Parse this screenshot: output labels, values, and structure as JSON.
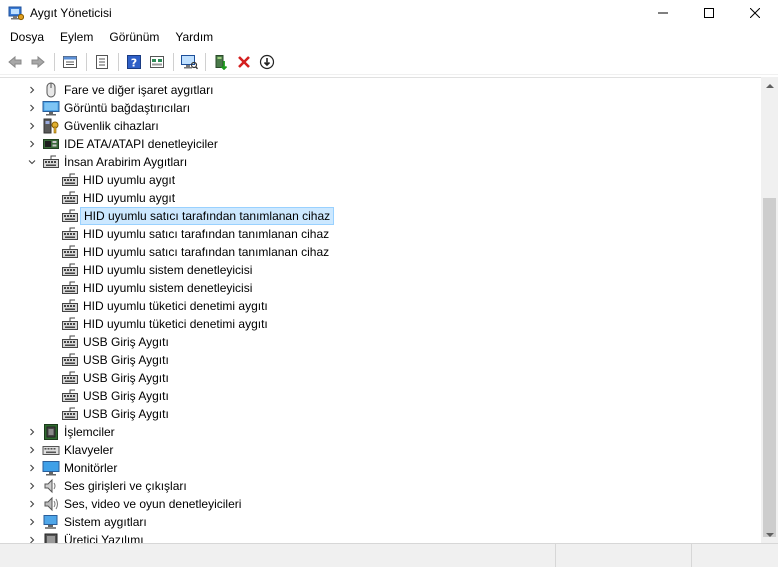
{
  "window": {
    "title": "Aygıt Yöneticisi",
    "minimize_glyph": "—",
    "maximize_glyph": "☐",
    "close_glyph": "✕"
  },
  "menu": [
    "Dosya",
    "Eylem",
    "Görünüm",
    "Yardım"
  ],
  "toolbar": {
    "buttons": [
      "back-icon",
      "forward-icon",
      "properties-icon",
      "console-tree-icon",
      "help-icon",
      "scan-hardware-icon",
      "update-driver-icon",
      "uninstall-icon",
      "disable-icon"
    ]
  },
  "tree": {
    "categories_before": [
      {
        "label": "Fare ve diğer işaret aygıtları",
        "icon": "mouse-icon",
        "expanded": false
      },
      {
        "label": "Görüntü bağdaştırıcıları",
        "icon": "display-adapter-icon",
        "expanded": false
      },
      {
        "label": "Güvenlik cihazları",
        "icon": "security-icon",
        "expanded": false
      },
      {
        "label": "IDE ATA/ATAPI denetleyiciler",
        "icon": "ide-icon",
        "expanded": false
      },
      {
        "label": "İnsan Arabirim Aygıtları",
        "icon": "hid-icon",
        "expanded": true
      }
    ],
    "hid_children": [
      {
        "label": "HID uyumlu aygıt",
        "selected": false
      },
      {
        "label": "HID uyumlu aygıt",
        "selected": false
      },
      {
        "label": "HID uyumlu satıcı tarafından tanımlanan cihaz",
        "selected": true
      },
      {
        "label": "HID uyumlu satıcı tarafından tanımlanan cihaz",
        "selected": false
      },
      {
        "label": "HID uyumlu satıcı tarafından tanımlanan cihaz",
        "selected": false
      },
      {
        "label": "HID uyumlu sistem denetleyicisi",
        "selected": false
      },
      {
        "label": "HID uyumlu sistem denetleyicisi",
        "selected": false
      },
      {
        "label": "HID uyumlu tüketici denetimi aygıtı",
        "selected": false
      },
      {
        "label": "HID uyumlu tüketici denetimi aygıtı",
        "selected": false
      },
      {
        "label": "USB Giriş Aygıtı",
        "selected": false
      },
      {
        "label": "USB Giriş Aygıtı",
        "selected": false
      },
      {
        "label": "USB Giriş Aygıtı",
        "selected": false
      },
      {
        "label": "USB Giriş Aygıtı",
        "selected": false
      },
      {
        "label": "USB Giriş Aygıtı",
        "selected": false
      }
    ],
    "categories_after": [
      {
        "label": "İşlemciler",
        "icon": "processor-icon",
        "expanded": false
      },
      {
        "label": "Klavyeler",
        "icon": "keyboard-icon",
        "expanded": false
      },
      {
        "label": "Monitörler",
        "icon": "monitor-icon",
        "expanded": false
      },
      {
        "label": "Ses girişleri ve çıkışları",
        "icon": "audio-io-icon",
        "expanded": false
      },
      {
        "label": "Ses, video ve oyun denetleyicileri",
        "icon": "sound-video-icon",
        "expanded": false
      },
      {
        "label": "Sistem aygıtları",
        "icon": "system-devices-icon",
        "expanded": false
      },
      {
        "label": "Üretici Yazılımı",
        "icon": "firmware-icon",
        "expanded": false
      }
    ]
  },
  "colors": {
    "selection_bg": "#cce8ff",
    "selection_border": "#99d1ff"
  }
}
